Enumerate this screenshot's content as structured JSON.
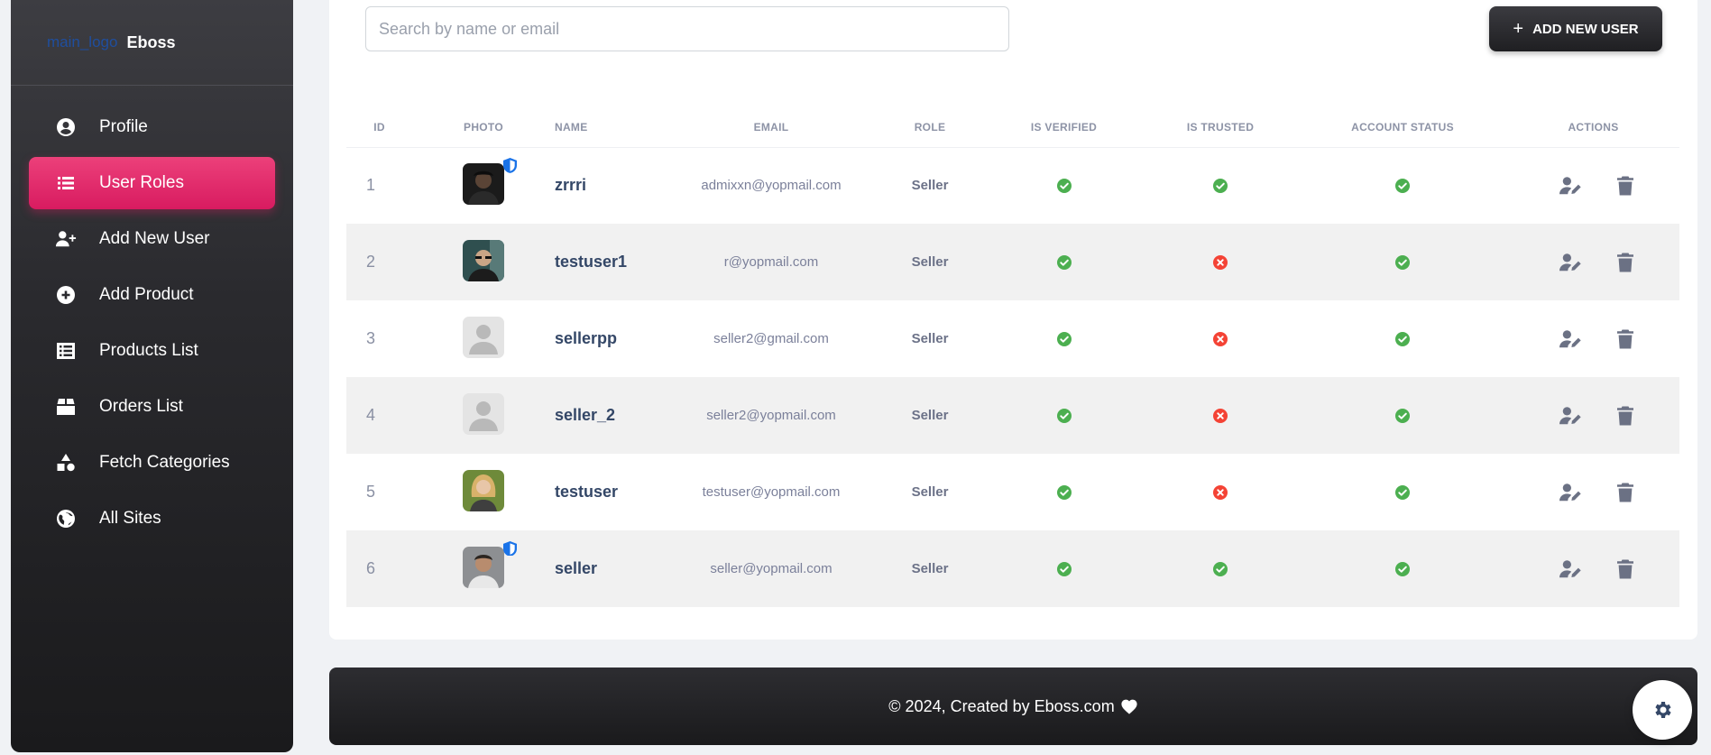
{
  "brand": {
    "logo_alt": "main_logo",
    "name": "Eboss"
  },
  "sidebar": {
    "items": [
      {
        "label": "Profile",
        "icon": "user-circle-icon"
      },
      {
        "label": "User Roles",
        "icon": "list-icon",
        "active": true
      },
      {
        "label": "Add New User",
        "icon": "user-plus-icon"
      },
      {
        "label": "Add Product",
        "icon": "plus-circle-icon"
      },
      {
        "label": "Products List",
        "icon": "list-alt-icon"
      },
      {
        "label": "Orders List",
        "icon": "box-icon"
      },
      {
        "label": "Fetch Categories",
        "icon": "shapes-icon"
      },
      {
        "label": "All Sites",
        "icon": "globe-icon"
      }
    ]
  },
  "search": {
    "placeholder": "Search by name or email",
    "value": ""
  },
  "add_button": {
    "label": "ADD NEW USER"
  },
  "table": {
    "headers": [
      "ID",
      "PHOTO",
      "NAME",
      "EMAIL",
      "ROLE",
      "IS VERIFIED",
      "IS TRUSTED",
      "ACCOUNT STATUS",
      "ACTIONS"
    ],
    "rows": [
      {
        "id": "1",
        "name": "zrrri",
        "email": "admixxn@yopmail.com",
        "role": "Seller",
        "photo": "dark-portrait",
        "shield": true,
        "verified": true,
        "trusted": true,
        "active": true
      },
      {
        "id": "2",
        "name": "testuser1",
        "email": "r@yopmail.com",
        "role": "Seller",
        "photo": "glasses-portrait",
        "shield": false,
        "verified": true,
        "trusted": false,
        "active": true
      },
      {
        "id": "3",
        "name": "sellerpp",
        "email": "seller2@gmail.com",
        "role": "Seller",
        "photo": "placeholder",
        "shield": false,
        "verified": true,
        "trusted": false,
        "active": true
      },
      {
        "id": "4",
        "name": "seller_2",
        "email": "seller2@yopmail.com",
        "role": "Seller",
        "photo": "placeholder",
        "shield": false,
        "verified": true,
        "trusted": false,
        "active": true
      },
      {
        "id": "5",
        "name": "testuser",
        "email": "testuser@yopmail.com",
        "role": "Seller",
        "photo": "blonde-portrait",
        "shield": false,
        "verified": true,
        "trusted": false,
        "active": true
      },
      {
        "id": "6",
        "name": "seller",
        "email": "seller@yopmail.com",
        "role": "Seller",
        "photo": "man-portrait",
        "shield": true,
        "verified": true,
        "trusted": true,
        "active": true
      }
    ]
  },
  "footer": {
    "text": "© 2024, Created by Eboss.com"
  },
  "colors": {
    "accent": "#e91e63",
    "success": "#4caf50",
    "error": "#f44335",
    "dark": "#1f1f22"
  }
}
